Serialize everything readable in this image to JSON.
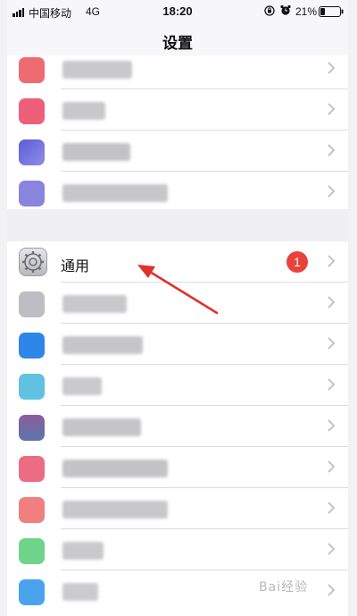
{
  "status_bar": {
    "carrier": "中国移动",
    "network": "4G",
    "time": "18:20",
    "battery_percent": "21%",
    "icons": [
      "signal-icon",
      "orientation-lock-icon",
      "alarm-icon",
      "battery-icon"
    ]
  },
  "nav": {
    "title": "设置"
  },
  "settings": {
    "general": {
      "label": "通用",
      "badge": "1",
      "icon": "gear-icon"
    }
  },
  "colors": {
    "badge_red": "#e8433a",
    "arrow_red": "#e2302a",
    "separator": "#dcdcdf",
    "group_gap": "#efeff4"
  },
  "watermark": "Bai经验"
}
